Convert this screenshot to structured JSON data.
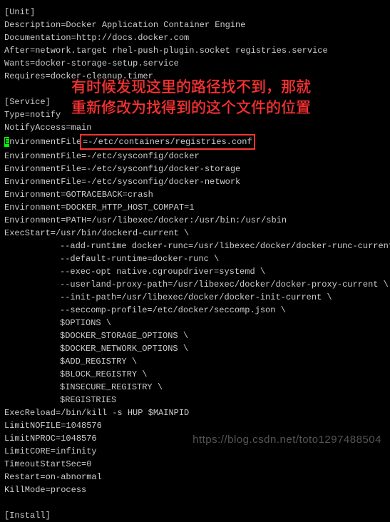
{
  "unit": {
    "header": "[Unit]",
    "description": "Description=Docker Application Container Engine",
    "documentation": "Documentation=http://docs.docker.com",
    "after": "After=network.target rhel-push-plugin.socket registries.service",
    "wants": "Wants=docker-storage-setup.service",
    "requires": "Requires=docker-cleanup.timer"
  },
  "service": {
    "header": "[Service]",
    "type": "Type=notify",
    "notify_access": "NotifyAccess=main",
    "env_file_cursor": "E",
    "env_file_prefix": "nvironmentFile",
    "env_file_highlighted": "=-/etc/containers/registries.conf",
    "env_file_2": "EnvironmentFile=-/etc/sysconfig/docker",
    "env_file_3": "EnvironmentFile=-/etc/sysconfig/docker-storage",
    "env_file_4": "EnvironmentFile=-/etc/sysconfig/docker-network",
    "env_gotraceback": "Environment=GOTRACEBACK=crash",
    "env_http_compat": "Environment=DOCKER_HTTP_HOST_COMPAT=1",
    "env_path": "Environment=PATH=/usr/libexec/docker:/usr/bin:/usr/sbin",
    "exec_start": "ExecStart=/usr/bin/dockerd-current \\",
    "exec_lines": [
      "--add-runtime docker-runc=/usr/libexec/docker/docker-runc-current \\",
      "--default-runtime=docker-runc \\",
      "--exec-opt native.cgroupdriver=systemd \\",
      "--userland-proxy-path=/usr/libexec/docker/docker-proxy-current \\",
      "--init-path=/usr/libexec/docker/docker-init-current \\",
      "--seccomp-profile=/etc/docker/seccomp.json \\",
      "$OPTIONS \\",
      "$DOCKER_STORAGE_OPTIONS \\",
      "$DOCKER_NETWORK_OPTIONS \\",
      "$ADD_REGISTRY \\",
      "$BLOCK_REGISTRY \\",
      "$INSECURE_REGISTRY \\",
      "$REGISTRIES"
    ],
    "exec_reload": "ExecReload=/bin/kill -s HUP $MAINPID",
    "limit_nofile": "LimitNOFILE=1048576",
    "limit_nproc": "LimitNPROC=1048576",
    "limit_core": "LimitCORE=infinity",
    "timeout": "TimeoutStartSec=0",
    "restart": "Restart=on-abnormal",
    "killmode": "KillMode=process"
  },
  "install": {
    "header": "[Install]"
  },
  "annotation": {
    "line1": "有时候发现这里的路径找不到，那就",
    "line2": "重新修改为找得到的这个文件的位置"
  },
  "watermark": "https://blog.csdn.net/toto1297488504"
}
